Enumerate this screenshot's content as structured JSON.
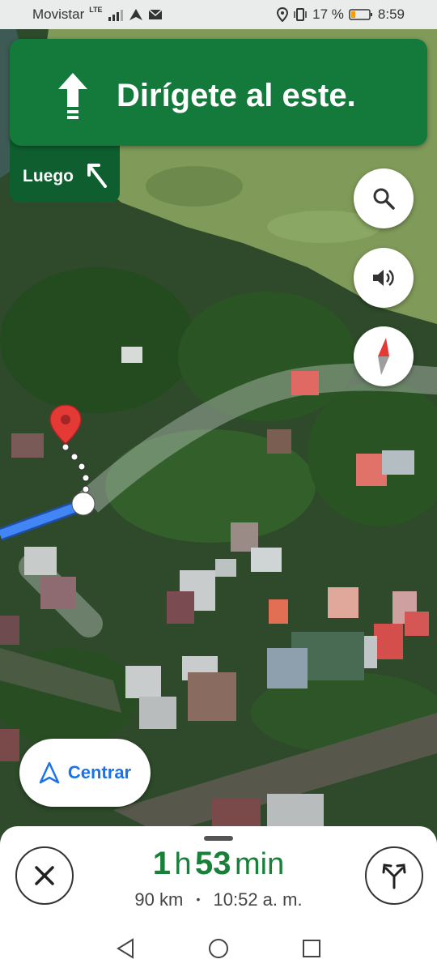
{
  "status_bar": {
    "carrier": "Movistar",
    "network": "LTE",
    "battery": "17 %",
    "time": "8:59"
  },
  "navigation": {
    "instruction": "Dirígete al este.",
    "then_label": "Luego",
    "direction_icon": "arrow-up-icon",
    "then_icon": "turn-left-icon"
  },
  "map_controls": {
    "search_icon": "search-icon",
    "sound_icon": "volume-icon",
    "compass_icon": "compass-icon"
  },
  "recenter": {
    "label": "Centrar",
    "icon": "navigation-arrow-icon"
  },
  "trip": {
    "hours": "1",
    "hours_unit": "h",
    "minutes": "53",
    "minutes_unit": "min",
    "distance": "90 km",
    "separator": "•",
    "arrival": "10:52 a. m."
  },
  "colors": {
    "nav_green": "#137a3c",
    "then_green": "#0e5e2f",
    "route_blue": "#4285f4",
    "eta_green": "#188038",
    "accent_blue": "#1a73e8",
    "pin_red": "#e53935"
  }
}
